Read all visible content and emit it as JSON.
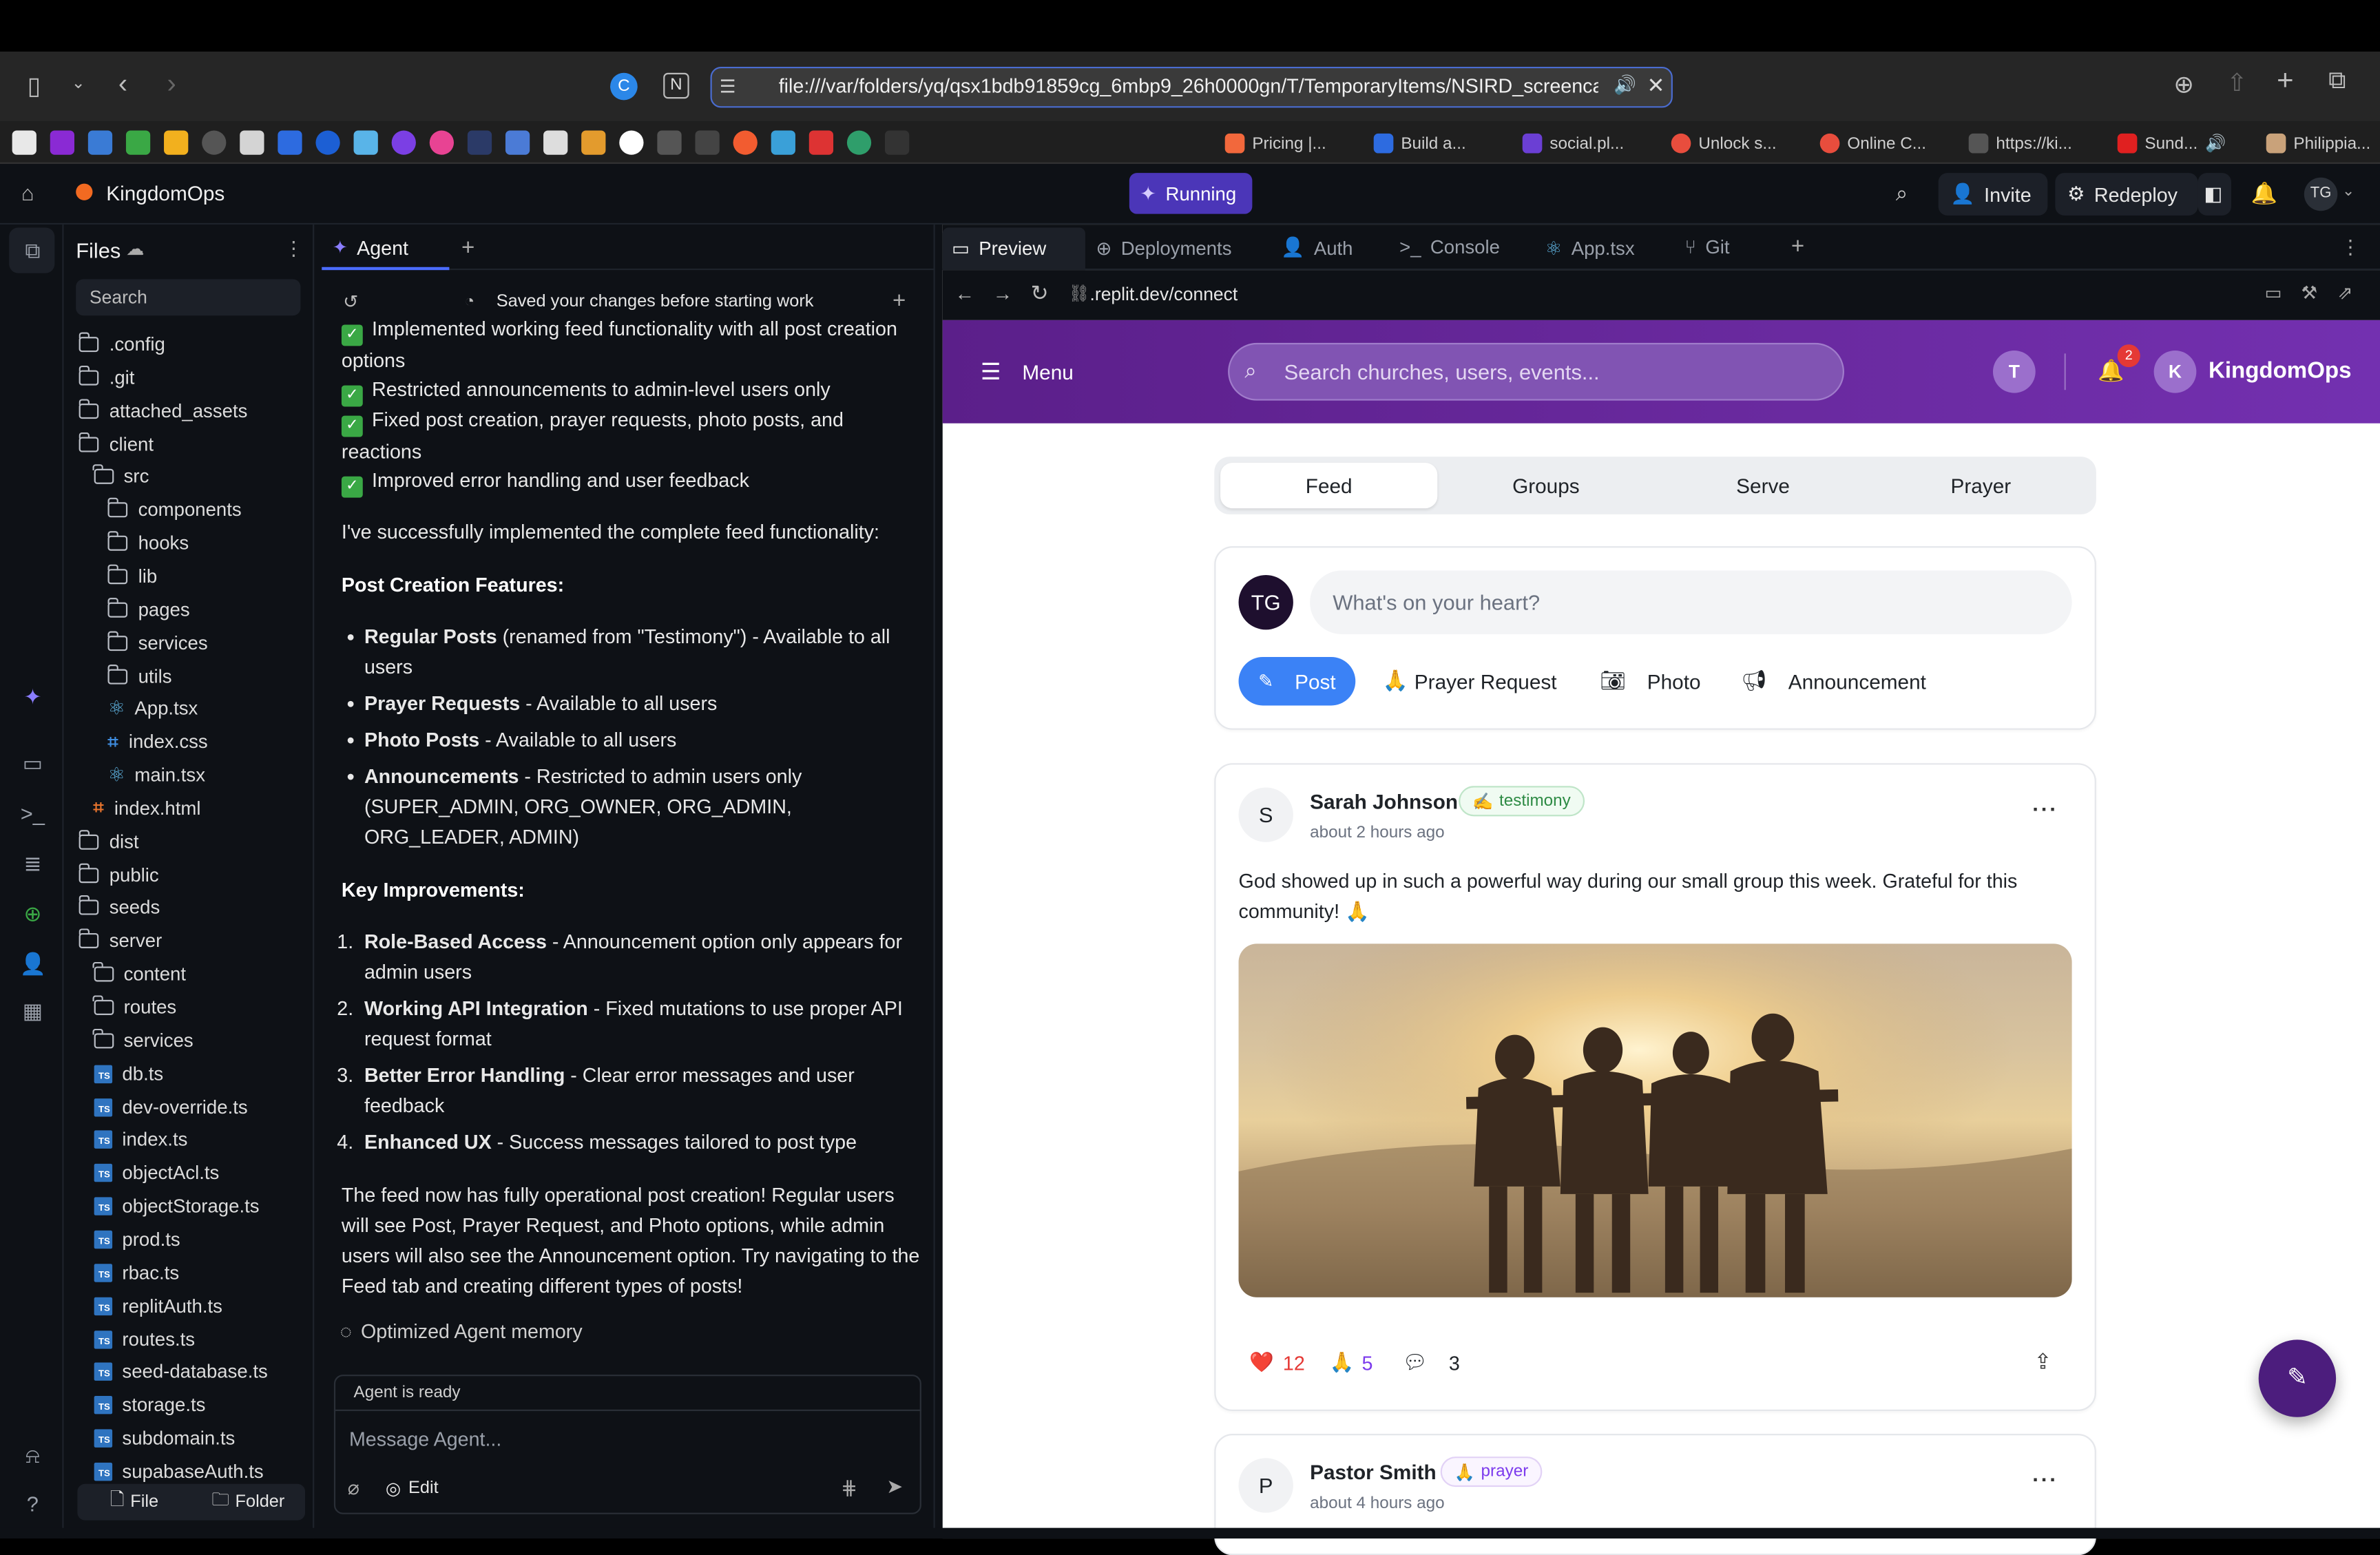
{
  "browser": {
    "url": "file:///var/folders/yq/qsx1bdb91859cg_6mbp9_26h0000gn/T/TemporaryItems/NSIRD_screencaptur",
    "tabs": [
      {
        "label": "Pricing |..."
      },
      {
        "label": "Build a..."
      },
      {
        "label": "social.pl..."
      },
      {
        "label": "Unlock s..."
      },
      {
        "label": "Online C..."
      },
      {
        "label": "https://ki..."
      },
      {
        "label": "Sund..."
      },
      {
        "label": "Philippia..."
      }
    ]
  },
  "replit": {
    "project_name": "KingdomOps",
    "run_status": "Running",
    "invite_label": "Invite",
    "redeploy_label": "Redeploy",
    "user_initials": "TG"
  },
  "files": {
    "title": "Files",
    "search_placeholder": "Search",
    "items": [
      {
        "label": ".config",
        "type": "folder"
      },
      {
        "label": ".git",
        "type": "folder"
      },
      {
        "label": "attached_assets",
        "type": "folder"
      },
      {
        "label": "client",
        "type": "folder"
      },
      {
        "label": "src",
        "type": "folder"
      },
      {
        "label": "components",
        "type": "folder"
      },
      {
        "label": "hooks",
        "type": "folder"
      },
      {
        "label": "lib",
        "type": "folder"
      },
      {
        "label": "pages",
        "type": "folder"
      },
      {
        "label": "services",
        "type": "folder"
      },
      {
        "label": "utils",
        "type": "folder"
      },
      {
        "label": "App.tsx",
        "type": "react"
      },
      {
        "label": "index.css",
        "type": "css"
      },
      {
        "label": "main.tsx",
        "type": "react"
      },
      {
        "label": "index.html",
        "type": "html"
      },
      {
        "label": "dist",
        "type": "folder"
      },
      {
        "label": "public",
        "type": "folder"
      },
      {
        "label": "seeds",
        "type": "folder"
      },
      {
        "label": "server",
        "type": "folder"
      },
      {
        "label": "content",
        "type": "folder"
      },
      {
        "label": "routes",
        "type": "folder"
      },
      {
        "label": "services",
        "type": "folder"
      },
      {
        "label": "db.ts",
        "type": "ts"
      },
      {
        "label": "dev-override.ts",
        "type": "ts"
      },
      {
        "label": "index.ts",
        "type": "ts"
      },
      {
        "label": "objectAcl.ts",
        "type": "ts"
      },
      {
        "label": "objectStorage.ts",
        "type": "ts"
      },
      {
        "label": "prod.ts",
        "type": "ts"
      },
      {
        "label": "rbac.ts",
        "type": "ts"
      },
      {
        "label": "replitAuth.ts",
        "type": "ts"
      },
      {
        "label": "routes.ts",
        "type": "ts"
      },
      {
        "label": "seed-database.ts",
        "type": "ts"
      },
      {
        "label": "storage.ts",
        "type": "ts"
      },
      {
        "label": "subdomain.ts",
        "type": "ts"
      },
      {
        "label": "supabaseAuth.ts",
        "type": "ts"
      }
    ],
    "new_file_label": "File",
    "new_folder_label": "Folder"
  },
  "agent": {
    "tab_label": "Agent",
    "saved_notice": "Saved your changes before starting work",
    "checks": [
      "Implemented working feed functionality with all post creation options",
      "Restricted announcements to admin-level users only",
      "Fixed post creation, prayer requests, photo posts, and reactions",
      "Improved error handling and user feedback"
    ],
    "intro": "I've successfully implemented the complete feed functionality:",
    "features_heading": "Post Creation Features:",
    "features": [
      {
        "title": "Regular Posts",
        "desc": " (renamed from \"Testimony\") - Available to all users"
      },
      {
        "title": "Prayer Requests",
        "desc": " - Available to all users"
      },
      {
        "title": "Photo Posts",
        "desc": " - Available to all users"
      },
      {
        "title": "Announcements",
        "desc": " - Restricted to admin users only (SUPER_ADMIN, ORG_OWNER, ORG_ADMIN, ORG_LEADER, ADMIN)"
      }
    ],
    "improvements_heading": "Key Improvements:",
    "improvements": [
      {
        "n": "1.",
        "title": "Role-Based Access",
        "desc": " - Announcement option only appears for admin users"
      },
      {
        "n": "2.",
        "title": "Working API Integration",
        "desc": " - Fixed mutations to use proper API request format"
      },
      {
        "n": "3.",
        "title": "Better Error Handling",
        "desc": " - Clear error messages and user feedback"
      },
      {
        "n": "4.",
        "title": "Enhanced UX",
        "desc": " - Success messages tailored to post type"
      }
    ],
    "closing": "The feed now has fully operational post creation! Regular users will see Post, Prayer Request, and Photo options, while admin users will also see the Announcement option. Try navigating to the Feed tab and creating different types of posts!",
    "memory_note": "Optimized Agent memory",
    "status": "Agent is ready",
    "input_placeholder": "Message Agent...",
    "edit_label": "Edit"
  },
  "preview_tabs": [
    {
      "label": "Preview"
    },
    {
      "label": "Deployments"
    },
    {
      "label": "Auth"
    },
    {
      "label": "Console"
    },
    {
      "label": "App.tsx"
    },
    {
      "label": "Git"
    }
  ],
  "preview_url": ".replit.dev/connect",
  "app": {
    "menu_label": "Menu",
    "search_placeholder": "Search churches, users, events...",
    "user_initial": "T",
    "notification_count": "2",
    "brand_initial": "K",
    "brand_name": "KingdomOps",
    "tabs": [
      "Feed",
      "Groups",
      "Serve",
      "Prayer"
    ],
    "composer": {
      "avatar": "TG",
      "placeholder": "What's on your heart?",
      "post": "Post",
      "prayer_request": "Prayer Request",
      "photo": "Photo",
      "announcement": "Announcement"
    },
    "posts": [
      {
        "initial": "S",
        "author": "Sarah Johnson",
        "badge": "testimony",
        "time": "about 2 hours ago",
        "body": "God showed up in such a powerful way during our small group this week. Grateful for this community! 🙏",
        "hearts": "12",
        "prayers": "5",
        "comments": "3"
      },
      {
        "initial": "P",
        "author": "Pastor Smith",
        "badge": "prayer",
        "time": "about 4 hours ago"
      }
    ]
  },
  "colors": {
    "accent_purple": "#6a2aa0",
    "running": "#4b36b8",
    "post_button": "#3b82f6",
    "check_green": "#3aa845"
  }
}
